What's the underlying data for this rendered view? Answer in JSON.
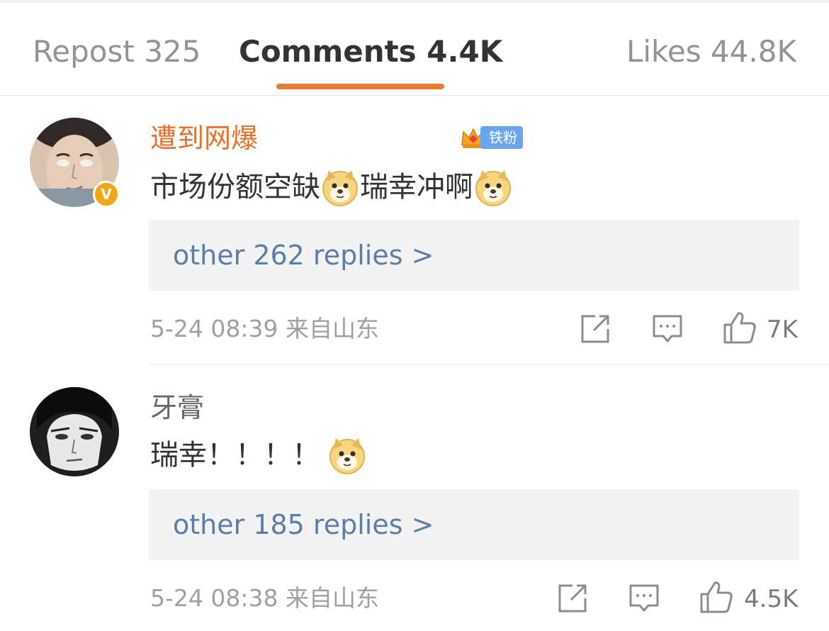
{
  "tabs": {
    "repost": "Repost 325",
    "comments": "Comments 4.4K",
    "likes": "Likes 44.8K",
    "active_color": "#eb7a31"
  },
  "comments": [
    {
      "username": "遭到网爆",
      "badge": "铁粉",
      "verified": "V",
      "text_parts": [
        "市场份额空缺",
        "瑞幸冲啊"
      ],
      "emoji": "doge-emoji",
      "replies": "other 262 replies >",
      "meta": "5-24 08:39 来自山东",
      "likes": "7K"
    },
    {
      "username": "牙膏",
      "text_parts": [
        "瑞幸！！！！"
      ],
      "emoji": "doge-emoji",
      "replies": "other 185 replies >",
      "meta": "5-24 08:38 来自山东",
      "likes": "4.5K"
    }
  ],
  "colors": {
    "username_highlight": "#e8712a",
    "reply_link": "#5b7ea8",
    "fan_badge": "#6aa5f0",
    "verified_badge": "#f2a611"
  }
}
